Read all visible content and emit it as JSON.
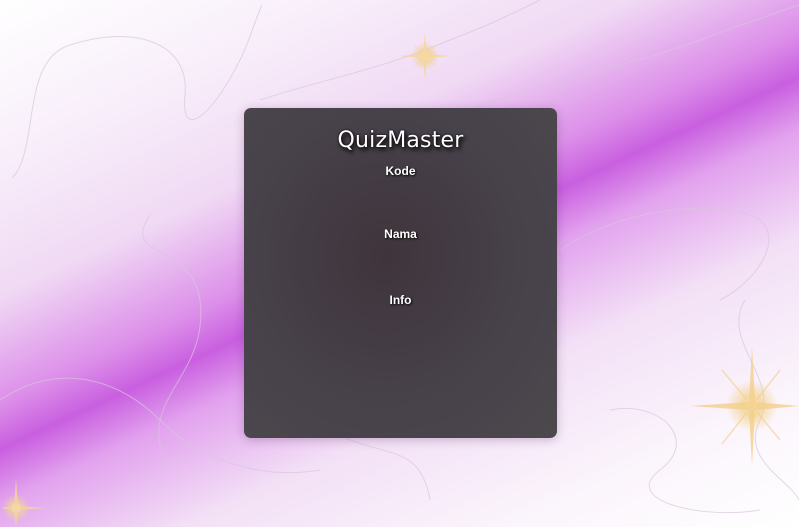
{
  "app": {
    "title": "QuizMaster"
  },
  "form": {
    "fields": [
      {
        "label": "Kode"
      },
      {
        "label": "Nama"
      },
      {
        "label": "Info"
      }
    ]
  },
  "colors": {
    "card_background": "#47414a",
    "accent_purple": "#c95fe0",
    "text": "#ffffff"
  },
  "icons": [
    "sparkle-icon"
  ]
}
